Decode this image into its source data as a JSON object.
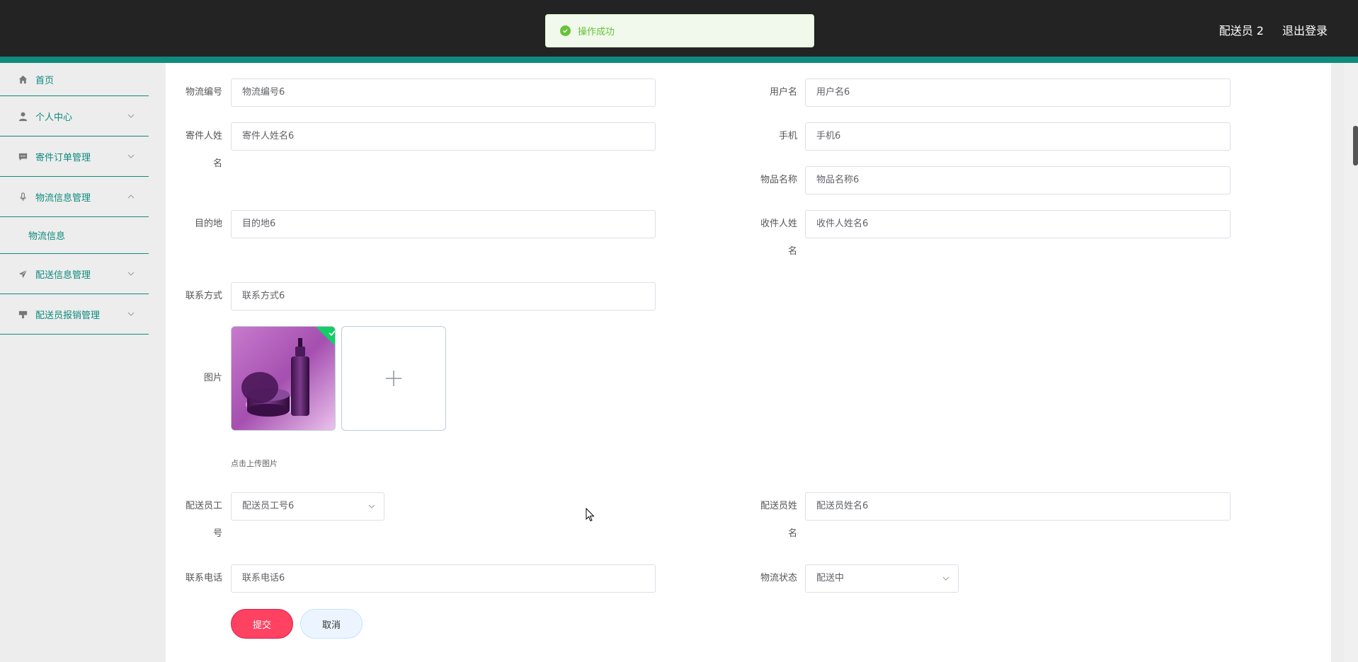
{
  "header": {
    "user_name": "配送员 2",
    "logout_label": "退出登录"
  },
  "toast": {
    "message": "操作成功",
    "color": "#67c23a"
  },
  "sidebar": {
    "items": [
      {
        "label": "首页",
        "icon": "home-icon"
      },
      {
        "label": "个人中心",
        "icon": "user-icon"
      },
      {
        "label": "寄件订单管理",
        "icon": "message-icon"
      },
      {
        "label": "物流信息管理",
        "icon": "microphone-icon"
      },
      {
        "label": "配送信息管理",
        "icon": "paper-plane-icon"
      },
      {
        "label": "配送员报销管理",
        "icon": "stamp-icon"
      }
    ],
    "sub_item": "物流信息"
  },
  "form": {
    "logistics_no": {
      "label": "物流编号",
      "value": "物流编号6"
    },
    "username": {
      "label": "用户名",
      "value": "用户名6"
    },
    "sender_name": {
      "label": "寄件人姓名",
      "value": "寄件人姓名6"
    },
    "phone": {
      "label": "手机",
      "value": "手机6"
    },
    "item_name": {
      "label": "物品名称",
      "value": "物品名称6"
    },
    "destination": {
      "label": "目的地",
      "value": "目的地6"
    },
    "receiver_name": {
      "label": "收件人姓名",
      "value": "收件人姓名6"
    },
    "contact": {
      "label": "联系方式",
      "value": "联系方式6"
    },
    "image": {
      "label": "图片",
      "hint": "点击上传图片"
    },
    "courier_no": {
      "label": "配送员工号",
      "value": "配送员工号6"
    },
    "courier_name": {
      "label": "配送员姓名",
      "value": "配送员姓名6"
    },
    "contact_phone": {
      "label": "联系电话",
      "value": "联系电话6"
    },
    "status": {
      "label": "物流状态",
      "value": "配送中"
    }
  },
  "actions": {
    "submit": "提交",
    "cancel": "取消"
  },
  "colors": {
    "accent": "#0e8b7e",
    "header_bg": "#232323",
    "submit_bg": "#ff4162"
  }
}
